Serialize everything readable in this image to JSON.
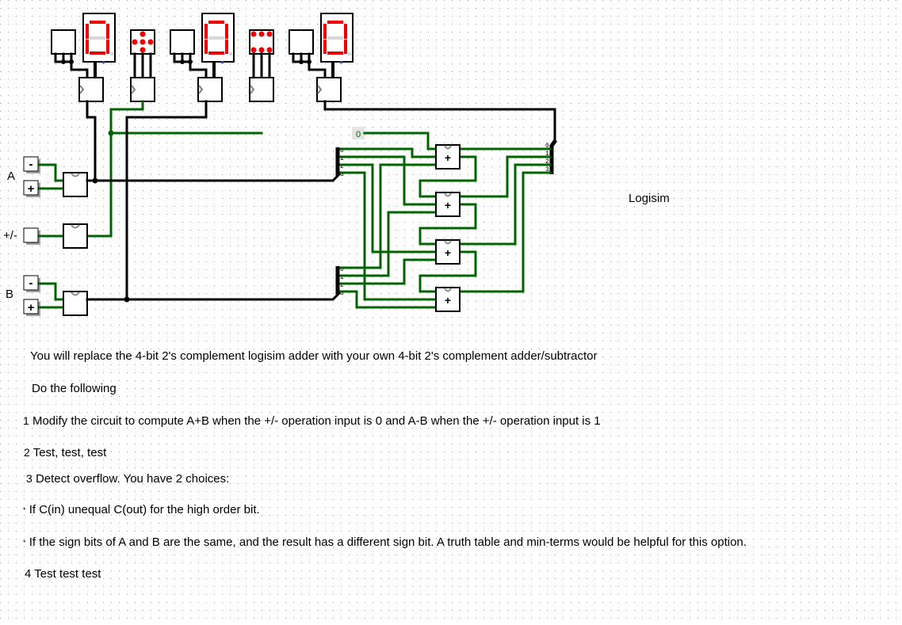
{
  "colors": {
    "wire_on": "#006400",
    "bus": "#000000",
    "segment_on": "#f00000",
    "segment_off": "#d8d8d8",
    "grid_dot": "#a0a0a0"
  },
  "inputs": {
    "a_label": "A",
    "op_label": "+/-",
    "b_label": "B",
    "minus_button": "-",
    "plus_button": "+"
  },
  "constant": {
    "value": "0"
  },
  "splitter_bits": [
    "0",
    "1",
    "2",
    "3"
  ],
  "adder_symbol": "+",
  "displays": [
    {
      "digit": "0"
    },
    {
      "digit": "0"
    },
    {
      "digit": "0"
    }
  ],
  "canvas_label": "Logisim",
  "instructions": {
    "intro": "You will replace the 4-bit 2's complement logisim adder with your own 4-bit 2's complement adder/subtractor",
    "heading": "Do the following",
    "steps": [
      {
        "num": "1",
        "text": "Modify the circuit to compute A+B when the +/- operation input is 0 and A-B when the +/- operation input is 1"
      },
      {
        "num": "2",
        "text": "Test, test, test"
      },
      {
        "num": "3",
        "text": "Detect overflow. You have 2 choices:"
      },
      {
        "num": "*",
        "text": "If C(in) unequal C(out) for the high order bit."
      },
      {
        "num": "*",
        "text": "If the sign bits of A and B are the same, and the result has a different sign bit. A truth table and min-terms would be helpful for this option."
      },
      {
        "num": "4",
        "text": "Test test test"
      }
    ]
  }
}
